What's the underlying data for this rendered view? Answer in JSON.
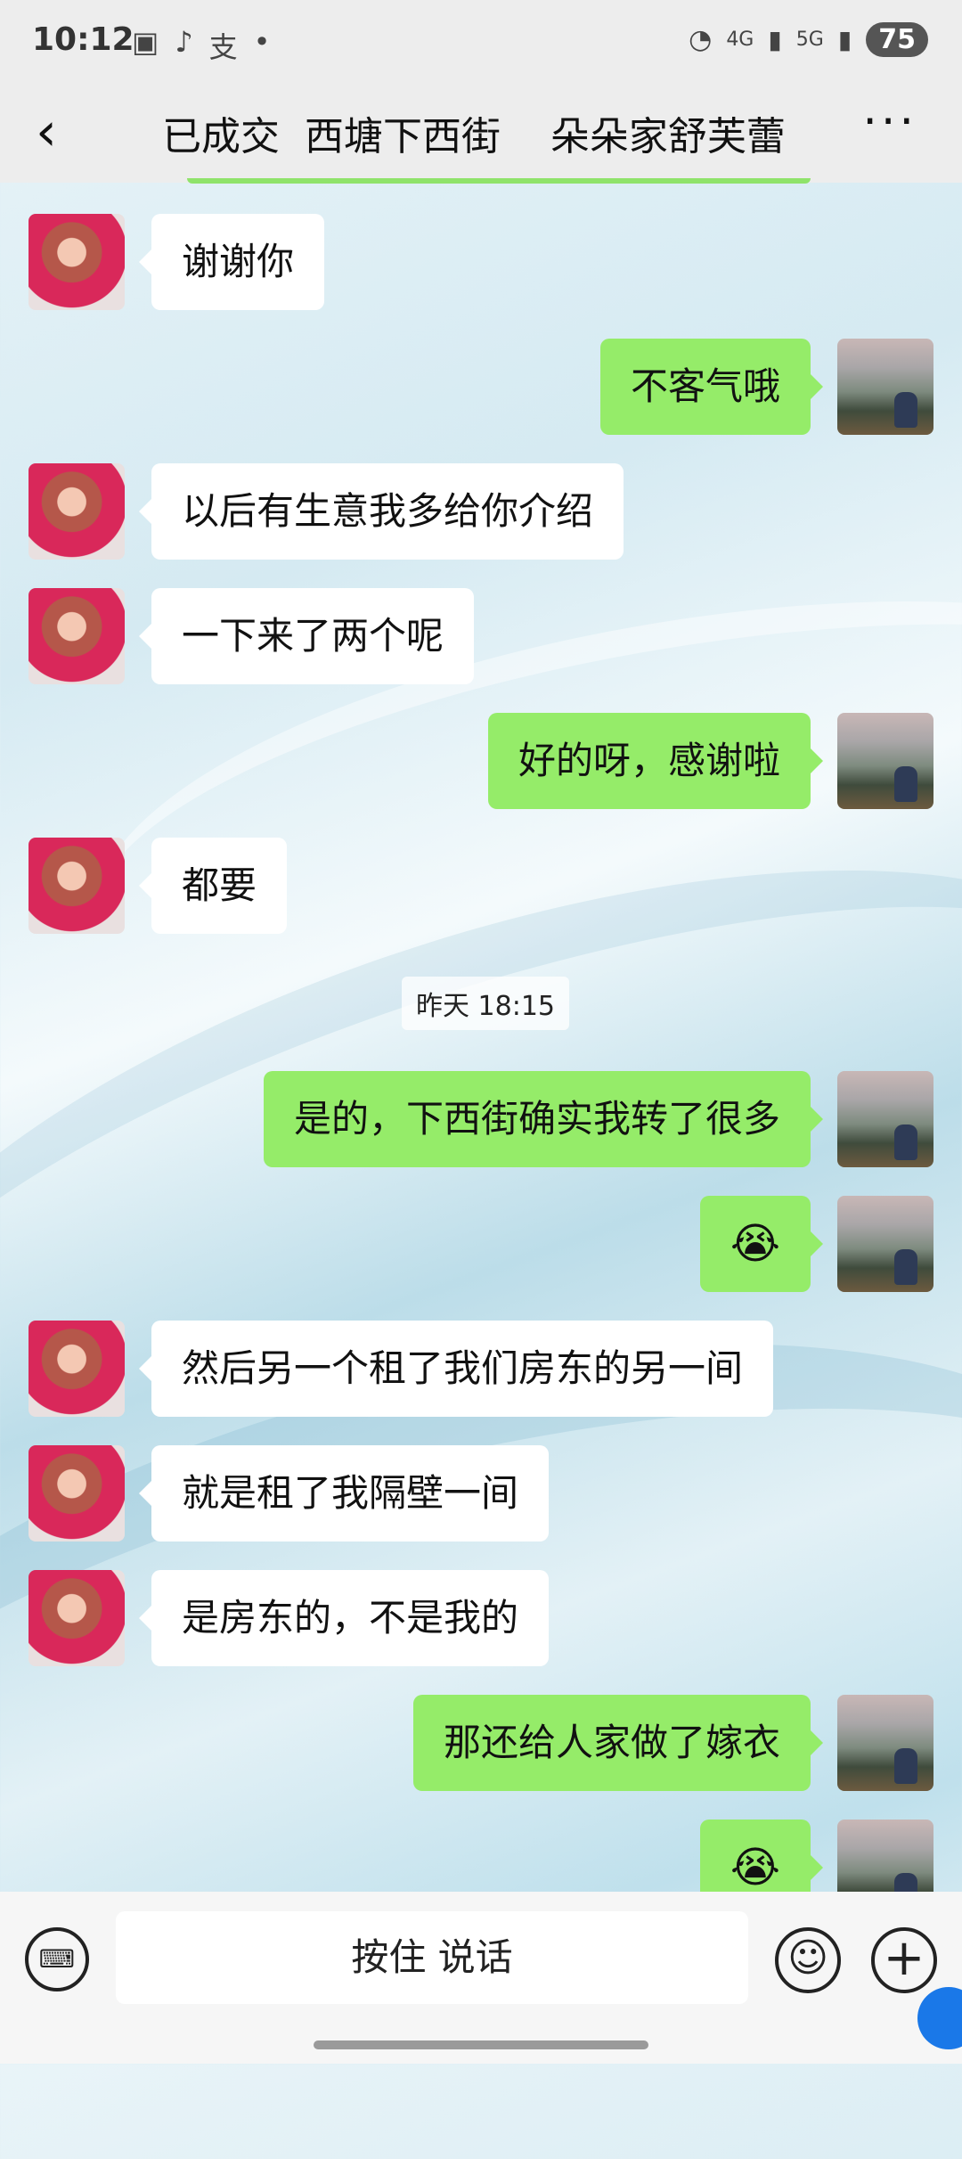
{
  "status_bar": {
    "time": "10:12",
    "network_4g": "4G",
    "network_5g": "5G",
    "battery": "75"
  },
  "header": {
    "back_icon": "chevron-left-icon",
    "title": "已成交  西塘下西街    朵朵家舒芙蕾",
    "more_icon": "more-dots-icon"
  },
  "messages": [
    {
      "side": "left",
      "text": "谢谢你"
    },
    {
      "side": "right",
      "text": "不客气哦"
    },
    {
      "side": "left",
      "text": "以后有生意我多给你介绍"
    },
    {
      "side": "left",
      "text": "一下来了两个呢"
    },
    {
      "side": "right",
      "text": "好的呀，感谢啦"
    },
    {
      "side": "left",
      "text": "都要"
    },
    {
      "side": "right",
      "text": "是的，下西街确实我转了很多"
    },
    {
      "side": "right",
      "text": "😭"
    },
    {
      "side": "left",
      "text": "然后另一个租了我们房东的另一间"
    },
    {
      "side": "left",
      "text": "就是租了我隔壁一间"
    },
    {
      "side": "left",
      "text": "是房东的，不是我的"
    },
    {
      "side": "right",
      "text": "那还给人家做了嫁衣"
    },
    {
      "side": "right",
      "text": "😭"
    }
  ],
  "timestamp": "昨天 18:15",
  "input_bar": {
    "hold_to_talk": "按住 说话",
    "keyboard_icon": "keyboard-icon",
    "emoji_icon": "smiley-icon",
    "plus_icon": "plus-icon"
  }
}
